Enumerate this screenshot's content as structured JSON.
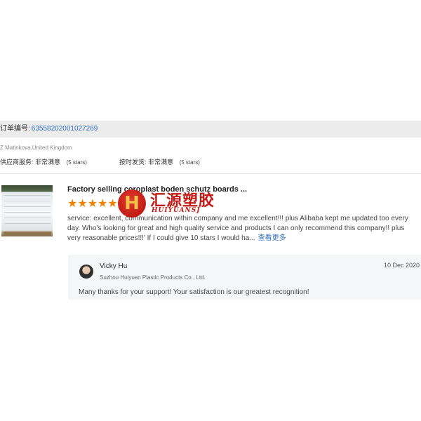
{
  "order": {
    "label": "订单编号:",
    "number": "63558202001027269"
  },
  "buyer": {
    "name_country": "Z Matinkova,United Kingdom"
  },
  "ratings": {
    "supplier_service_label": "供应商服务:",
    "supplier_service_value": "非常满意",
    "supplier_service_stars": "(5 stars)",
    "shipping_label": "按时发货:",
    "shipping_value": "非常满意",
    "shipping_stars": "(5 stars)"
  },
  "product": {
    "title": "Factory selling coroplast boden schutz boards ...",
    "rating_stars": 5,
    "star_glyphs": "★★★★★"
  },
  "review": {
    "text": "service: excellent, communication within company and me excellent!!! plus Alibaba kept me updated too every day. Who's looking for great and high quality service and products I can only recommend this company!! plus very reasonable prices!!!' If I could give 10 stars I would ha...",
    "more_link": "查看更多"
  },
  "logo": {
    "badge_letter": "H",
    "chinese_name": "汇源塑胶",
    "english_name": "HUIYUANSJ"
  },
  "reply": {
    "name": "Vicky Hu",
    "company": "Suzhou Huiyuan Plastic Products Co., Ltd.",
    "date": "10 Dec 2020",
    "text": "Many  thanks for your support! Your satisfaction is our greatest recognition!"
  },
  "colors": {
    "link": "#2f6fbf",
    "star": "#f08200",
    "logo_red": "#c21b14"
  }
}
